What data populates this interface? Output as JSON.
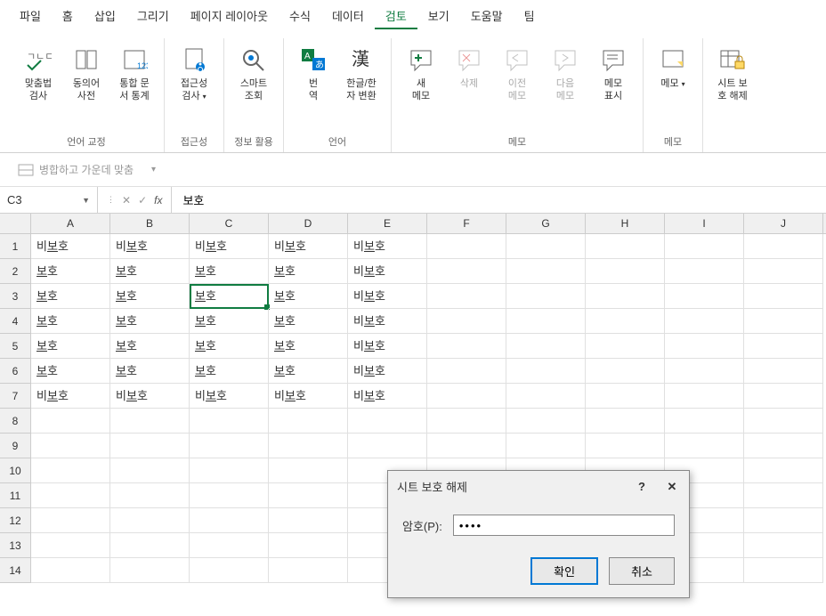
{
  "menu": [
    "파일",
    "홈",
    "삽입",
    "그리기",
    "페이지 레이아웃",
    "수식",
    "데이터",
    "검토",
    "보기",
    "도움말",
    "팀"
  ],
  "menu_active_index": 7,
  "ribbon_groups": [
    {
      "label": "언어 교정",
      "items": [
        {
          "label": "맞춤법\n검사",
          "icon": "spellcheck"
        },
        {
          "label": "동의어\n사전",
          "icon": "thesaurus"
        },
        {
          "label": "통합 문\n서 통계",
          "icon": "stats"
        }
      ]
    },
    {
      "label": "접근성",
      "items": [
        {
          "label": "접근성\n검사",
          "icon": "accessibility",
          "dropdown": true
        }
      ]
    },
    {
      "label": "정보 활용",
      "items": [
        {
          "label": "스마트\n조회",
          "icon": "smart-lookup"
        }
      ]
    },
    {
      "label": "언어",
      "items": [
        {
          "label": "번\n역",
          "icon": "translate"
        },
        {
          "label": "한글/한\n자 변환",
          "icon": "hanja"
        }
      ]
    },
    {
      "label": "메모",
      "items": [
        {
          "label": "새\n메모",
          "icon": "new-comment"
        },
        {
          "label": "삭제",
          "icon": "delete-comment",
          "disabled": true
        },
        {
          "label": "이전\n메모",
          "icon": "prev-comment",
          "disabled": true
        },
        {
          "label": "다음\n메모",
          "icon": "next-comment",
          "disabled": true
        },
        {
          "label": "메모\n표시",
          "icon": "show-comment"
        }
      ]
    },
    {
      "label": "메모",
      "items": [
        {
          "label": "메모",
          "icon": "memo",
          "dropdown": true
        }
      ]
    },
    {
      "label": "",
      "items": [
        {
          "label": "시트 보\n호 해제",
          "icon": "protect-sheet"
        }
      ]
    }
  ],
  "secondary_toolbar": {
    "merge_center": "병합하고 가운데 맞춤"
  },
  "name_box": "C3",
  "formula_value": "보호",
  "columns": [
    "A",
    "B",
    "C",
    "D",
    "E",
    "F",
    "G",
    "H",
    "I",
    "J"
  ],
  "rows": [
    {
      "num": 1,
      "cells": [
        "비보호",
        "비보호",
        "비보호",
        "비보호",
        "비보호",
        "",
        "",
        "",
        "",
        ""
      ]
    },
    {
      "num": 2,
      "cells": [
        "보호",
        "보호",
        "보호",
        "보호",
        "비보호",
        "",
        "",
        "",
        "",
        ""
      ]
    },
    {
      "num": 3,
      "cells": [
        "보호",
        "보호",
        "보호",
        "보호",
        "비보호",
        "",
        "",
        "",
        "",
        ""
      ]
    },
    {
      "num": 4,
      "cells": [
        "보호",
        "보호",
        "보호",
        "보호",
        "비보호",
        "",
        "",
        "",
        "",
        ""
      ]
    },
    {
      "num": 5,
      "cells": [
        "보호",
        "보호",
        "보호",
        "보호",
        "비보호",
        "",
        "",
        "",
        "",
        ""
      ]
    },
    {
      "num": 6,
      "cells": [
        "보호",
        "보호",
        "보호",
        "보호",
        "비보호",
        "",
        "",
        "",
        "",
        ""
      ]
    },
    {
      "num": 7,
      "cells": [
        "비보호",
        "비보호",
        "비보호",
        "비보호",
        "비보호",
        "",
        "",
        "",
        "",
        ""
      ]
    },
    {
      "num": 8,
      "cells": [
        "",
        "",
        "",
        "",
        "",
        "",
        "",
        "",
        "",
        ""
      ]
    },
    {
      "num": 9,
      "cells": [
        "",
        "",
        "",
        "",
        "",
        "",
        "",
        "",
        "",
        ""
      ]
    },
    {
      "num": 10,
      "cells": [
        "",
        "",
        "",
        "",
        "",
        "",
        "",
        "",
        "",
        ""
      ]
    },
    {
      "num": 11,
      "cells": [
        "",
        "",
        "",
        "",
        "",
        "",
        "",
        "",
        "",
        ""
      ]
    },
    {
      "num": 12,
      "cells": [
        "",
        "",
        "",
        "",
        "",
        "",
        "",
        "",
        "",
        ""
      ]
    },
    {
      "num": 13,
      "cells": [
        "",
        "",
        "",
        "",
        "",
        "",
        "",
        "",
        "",
        ""
      ]
    },
    {
      "num": 14,
      "cells": [
        "",
        "",
        "",
        "",
        "",
        "",
        "",
        "",
        "",
        ""
      ]
    }
  ],
  "selected_cell": {
    "row": 3,
    "col": 2
  },
  "dialog": {
    "title": "시트 보호 해제",
    "label": "암호(P):",
    "value": "••••",
    "ok": "확인",
    "cancel": "취소"
  }
}
